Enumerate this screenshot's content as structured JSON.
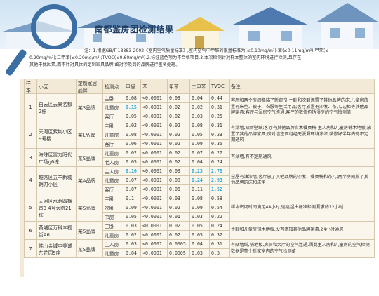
{
  "title": "南都鉴房团检测结果",
  "notes": [
    "注：1.根据GB/T 18883-2002《室内空气质量标准》,室内空气中甲醛的限量标准为(≤0.10mg/m³);苯(≤0.11mg/m³);甲苯(≤",
    "0.20mg/m³);二甲苯(≤0.20mg/m³);TVOC(≤0.60mg/m³).2.标注蓝色项为不合格项目.3.本次检测针对样本整体的室内环境进行检测,且存在",
    "其他干扰因素,而不针对具体的定制家具品牌,故对涉及到的品牌进行匿名处理。"
  ],
  "headers": [
    "样本",
    "小区",
    "定制家居品牌",
    "检测点",
    "甲醛",
    "苯",
    "甲苯",
    "二甲苯",
    "TVOC",
    "备注"
  ],
  "samples": [
    {
      "no": "1",
      "community": "白云区云景名都2栋",
      "brand": "某S品牌",
      "remark": "客厅和两个房间都装了新窗帘;主卧和次卧添置了其他品牌的床,儿童房放置有床垫、被子、衣服等生活用品;客厅放置有沙发、茶几,边柜等其他品牌家具;客厅与湿房空气连通,客厅的数值包括湿房的空气检测值",
      "rows": [
        [
          "主卧",
          "0.08",
          "<0.0001",
          "0.03",
          "0.04",
          "0.44"
        ],
        [
          "儿童房",
          "0.15",
          "<0.0001",
          "0.02",
          "0.02",
          "0.31"
        ],
        [
          "客厅",
          "0.05",
          "<0.0001",
          "0.02",
          "0.03",
          "0.25"
        ]
      ]
    },
    {
      "no": "2",
      "community": "天河区紫荆小区9号楼",
      "brand": "某L品牌",
      "remark": "有湖墙,贴新壁纸;客厅有其他品牌实木餐桌椅;主人房和儿童房铺木地板,放置了其他品牌家具;房对墙空面组经无脱漏环境涂漆,装修好半年内有不定期通风",
      "rows": [
        [
          "主卧",
          "0.02",
          "<0.0001",
          "0.02",
          "0.08",
          "0.31"
        ],
        [
          "儿童房",
          "0.08",
          "<0.0001",
          "0.02",
          "0.05",
          "0.23"
        ],
        [
          "客厅",
          "0.06",
          "<0.0001",
          "0.02",
          "0.09",
          "0.35"
        ]
      ]
    },
    {
      "no": "3",
      "community": "海珠区富力阳代广场g6栋",
      "brand": "某S品牌",
      "remark": "有湖墙,有不定期通风",
      "rows": [
        [
          "儿童房",
          "0.02",
          "<0.0001",
          "0.02",
          "0.07",
          "0.27"
        ],
        [
          "老人房",
          "0.05",
          "<0.0001",
          "0.02",
          "0.04",
          "0.24"
        ]
      ]
    },
    {
      "no": "4",
      "community": "越秀区五羊新城朝刀小区",
      "brand": "某A品牌",
      "remark": "全屋有油漆墙,客厅放了其他品牌的沙发、餐桌椅和茶几;两个房间放了其他品牌的床和床垫",
      "rows": [
        [
          "主人房",
          "0.16",
          "<0.0001",
          "0.09",
          "0.23",
          "2.78"
        ],
        [
          "儿童房",
          "0.07",
          "<0.0001",
          "0.08",
          "0.24",
          "2.93"
        ],
        [
          "客厅",
          "0.07",
          "<0.0001",
          "0.06",
          "0.11",
          "1.52"
        ]
      ]
    },
    {
      "no": "5",
      "community": "天河区水荫四横首3 4号大院21栋",
      "brand": "某S品牌",
      "remark": "样本密闭时间满足48小时,远远超出标准检测要求的12小时",
      "rows": [
        [
          "主卧",
          "0.1",
          "<0.0001",
          "0.03",
          "0.08",
          "0.58"
        ],
        [
          "次卧",
          "0.09",
          "<0.0001",
          "0.02",
          "0.09",
          "0.54"
        ],
        [
          "书房",
          "0.05",
          "<0.0001",
          "0.01",
          "0.03",
          "0.22"
        ]
      ]
    },
    {
      "no": "6",
      "community": "黄埔区万科幸福街A6",
      "brand": "某S品牌",
      "remark": "主卧和儿童房铺木地板,没有添加其他品牌家具,24小时通风",
      "rows": [
        [
          "主卧",
          "0.03",
          "<0.0001",
          "0.02",
          "0.05",
          "0.24"
        ],
        [
          "儿童房",
          "0.02",
          "<0.0001",
          "0.02",
          "0.05",
          "0.32"
        ]
      ]
    },
    {
      "no": "7",
      "community": "佛山金城中美诚东花园5座",
      "brand": "某S品牌",
      "remark": "有贴墙纸,铺地板,房间和大厅的空气连通,因此主人房和儿童房的空气检测数据是整个新家室内的空气检测值",
      "rows": [
        [
          "主人房",
          "0.03",
          "<0.0001",
          "0.0005",
          "0.04",
          "0.31"
        ],
        [
          "儿童房",
          "0.04",
          "<0.0001",
          "0.0005",
          "0.03",
          "0.3"
        ]
      ]
    }
  ],
  "highlight_cells": [
    {
      "sample": 0,
      "row": 1,
      "col": 1
    },
    {
      "sample": 3,
      "row": 0,
      "col": 1
    },
    {
      "sample": 3,
      "row": 0,
      "col": 4
    },
    {
      "sample": 3,
      "row": 0,
      "col": 5
    },
    {
      "sample": 3,
      "row": 1,
      "col": 4
    },
    {
      "sample": 3,
      "row": 1,
      "col": 5
    },
    {
      "sample": 3,
      "row": 2,
      "col": 5
    }
  ],
  "colors": {
    "highlight": "#2aa8d8",
    "header_bg": "#f2ead6",
    "cell_bg": "#faf6ec",
    "border": "#d6c8ac",
    "title": "#1f3f66"
  }
}
